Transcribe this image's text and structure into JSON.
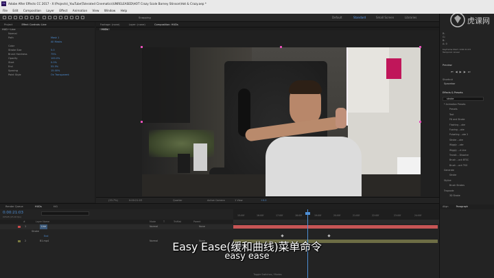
{
  "window": {
    "app_icon": "Ae",
    "title": "Adobe After Effects CC 2017 - X:\\Projects\\_YouTube\\Tolerated Cinematics\\UNRELEASED\\HOT Crazy Scale Barney Stinson\\Hot & Crazy.aep *"
  },
  "menu": [
    "File",
    "Edit",
    "Composition",
    "Layer",
    "Effect",
    "Animation",
    "View",
    "Window",
    "Help"
  ],
  "toolbar": {
    "workspaces": [
      "Default",
      "Standard",
      "Small Screen",
      "Libraries"
    ],
    "active_workspace": "Standard",
    "snapping_label": "Snapping",
    "search_placeholder": "Search Help"
  },
  "project_panel": {
    "tabs": [
      "Project",
      "Effect Controls: Line"
    ],
    "header": "HUD • Line",
    "rows": [
      {
        "label": "Normal",
        "value": ""
      },
      {
        "label": "Path",
        "value": "Mask 1"
      },
      {
        "label": "",
        "value": "All Masks"
      },
      {
        "label": "Color",
        "value": ""
      },
      {
        "label": "Stroke Size",
        "value": "5.0"
      },
      {
        "label": "Brush Hardness",
        "value": "75%"
      },
      {
        "label": "Opacity",
        "value": "100.0%"
      },
      {
        "label": "Start",
        "value": "0.0%"
      },
      {
        "label": "End",
        "value": "55.5%"
      },
      {
        "label": "Spacing",
        "value": "15.00%"
      },
      {
        "label": "Paint Style",
        "value": "On Transparent"
      }
    ]
  },
  "comp_panel": {
    "tabs": [
      "Footage: (none)",
      "Layer: (none)",
      "Composition: HUDs"
    ],
    "breadcrumb": "HUDs",
    "viewer_bar": {
      "zoom": "(33.7%)",
      "time": "0:00:21:03",
      "resolution": "Quarter",
      "camera": "Active Camera",
      "views": "1 View",
      "exposure": "+0.0"
    }
  },
  "timeline": {
    "tabs": [
      "Render Queue",
      "HUDs",
      "ttl1"
    ],
    "active_tab": "HUDs",
    "timecode": "0:00:21:03",
    "frame_info": "00528 (25.00 fps)",
    "columns": [
      "#",
      "Layer Name",
      "Mode",
      "T",
      "TrkMat",
      "Parent"
    ],
    "layers": [
      {
        "num": "1",
        "name": "Line",
        "mode": "Normal",
        "parent": "None"
      },
      {
        "num": "",
        "name": "Stroke",
        "mode": "",
        "parent": ""
      },
      {
        "num": "",
        "name": "End",
        "mode": "",
        "parent": ""
      },
      {
        "num": "2",
        "name": "B1.mp4",
        "mode": "Normal",
        "parent": "None"
      }
    ],
    "ruler_ticks": [
      "15:00f",
      "16:00f",
      "17:00f",
      "18:00f",
      "19:00f",
      "20:00f",
      "21:00f",
      "22:00f",
      "23:00f",
      "24:00f"
    ],
    "toggle_label": "Toggle Switches / Modes"
  },
  "right_panel": {
    "info_lines": [
      "R:",
      "G:",
      "B:",
      "A: 0"
    ],
    "info_lines2": [
      "X: 1800",
      "Y: 1362"
    ],
    "keyframe_info": [
      "Keyframe Start: 0:00:21:03",
      "Temporal: Linear"
    ],
    "preview_title": "Preview",
    "shortcut_label": "Shortcut",
    "shortcut_value": "Spacebar",
    "effects_title": "Effects & Presets",
    "effects_search": "stroke",
    "effects_tree": [
      "* Animation Presets",
      "Presets",
      "Text",
      "Fill and Stroke",
      "Flashing ...oke",
      "Fuzzing ...oke",
      "Pulsating ...oke 2",
      "Stroke ...oke",
      "Wiggly ...oke",
      "Wiggly ...d Line",
      "Transit... Dissolve",
      "Brush ...ock BTSC",
      "Brush ...ock TKG",
      "Generate",
      "Stroke",
      "Stylize",
      "Brush Strokes",
      "Trapcode",
      "3D Stroke"
    ],
    "align_tabs": [
      "Align",
      "Paragraph"
    ],
    "character_tabs": [
      "Character"
    ]
  },
  "subtitles": {
    "line1": "Easy Ease(缓和曲线)菜单命令",
    "line2": "easy ease"
  },
  "watermark": "虎课网"
}
